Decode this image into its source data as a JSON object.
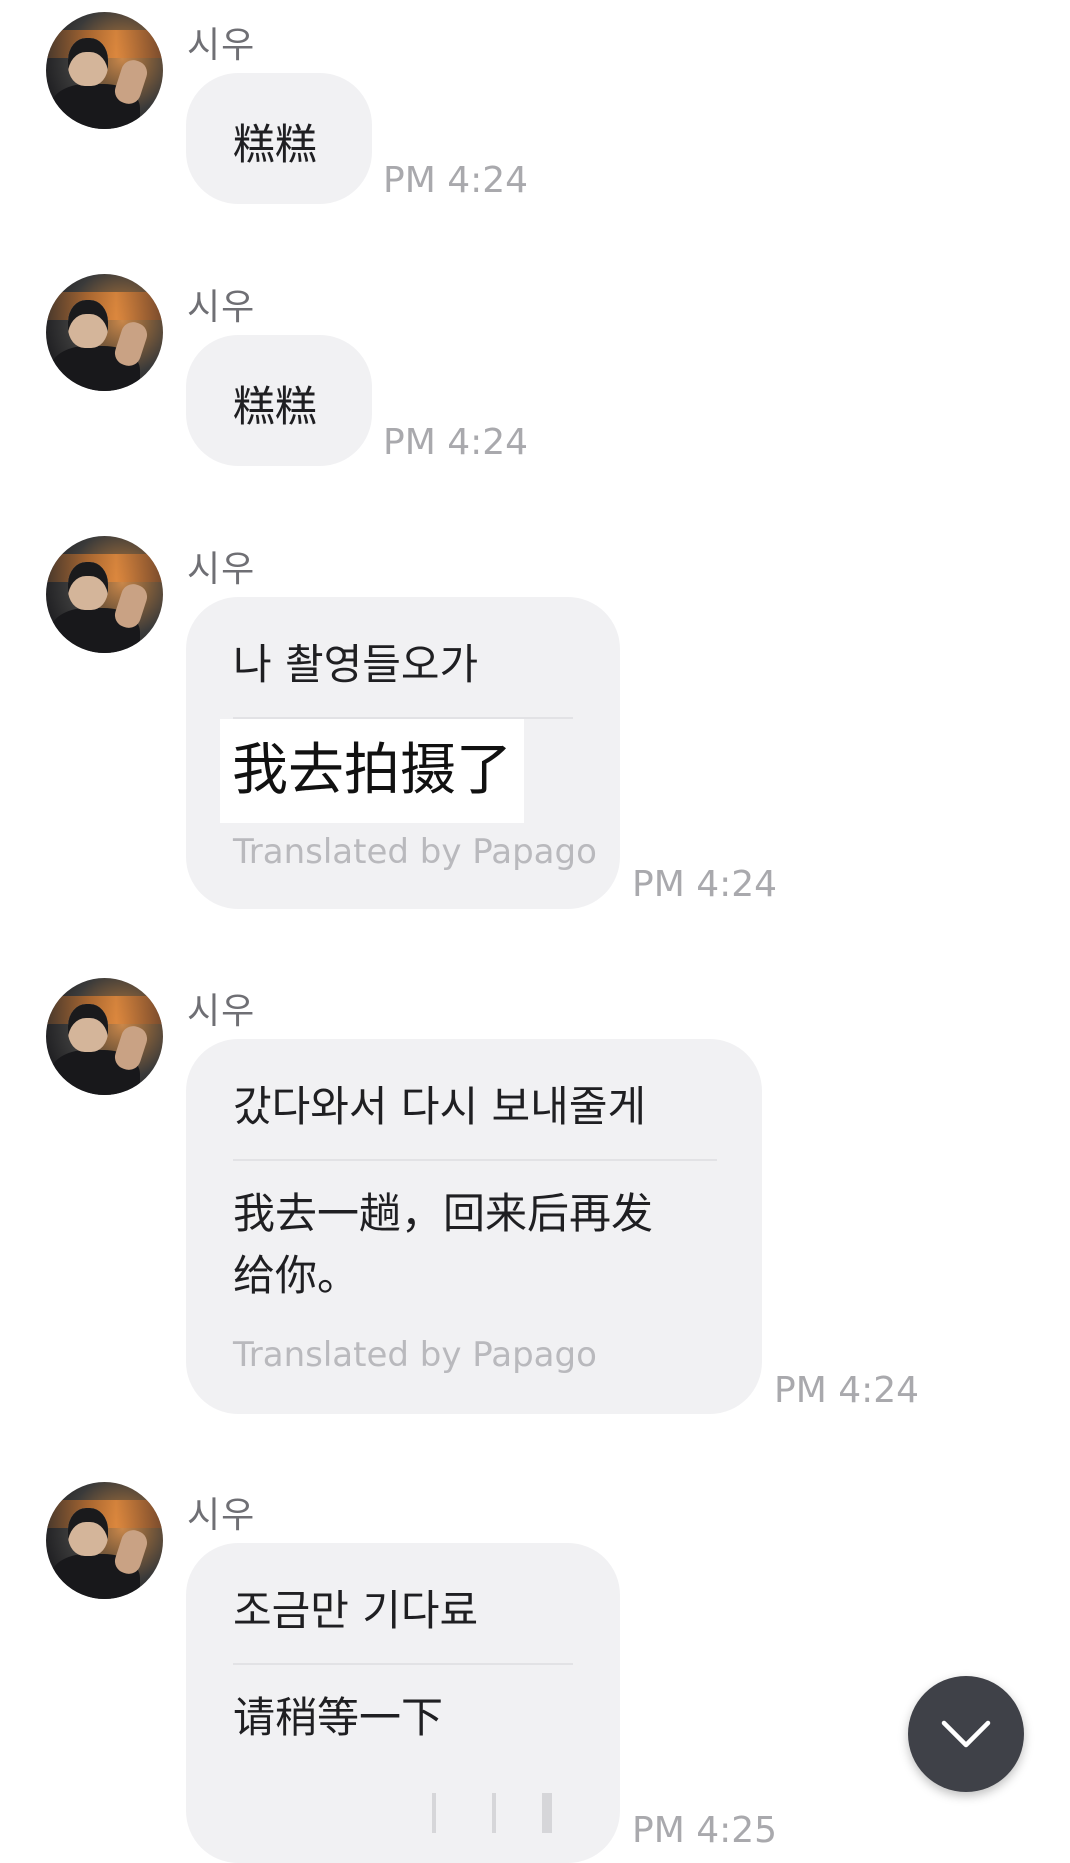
{
  "messages": [
    {
      "sender": "시우",
      "text": "糕糕",
      "time": "PM 4:24"
    },
    {
      "sender": "시우",
      "text": "糕糕",
      "time": "PM 4:24"
    },
    {
      "sender": "시우",
      "text": "나 촬영들오가",
      "translation": "我去拍摄了",
      "credit": "Translated by Papago",
      "time": "PM 4:24"
    },
    {
      "sender": "시우",
      "text": "갔다와서 다시 보내줄게",
      "translation_line1": "我去一趟，回来后再发",
      "translation_line2": "给你。",
      "credit": "Translated by Papago",
      "time": "PM 4:24"
    },
    {
      "sender": "시우",
      "text": "조금만 기다료",
      "translation": "请稍等一下",
      "time": "PM 4:25"
    }
  ],
  "icons": {
    "avatar": "profile-photo",
    "scroll_button": "chevron-down-icon"
  },
  "colors": {
    "bubble": "#f1f1f3",
    "timestamp": "#a9a9ad",
    "sender": "#6f6f74",
    "scroll_button": "#3f4148"
  }
}
